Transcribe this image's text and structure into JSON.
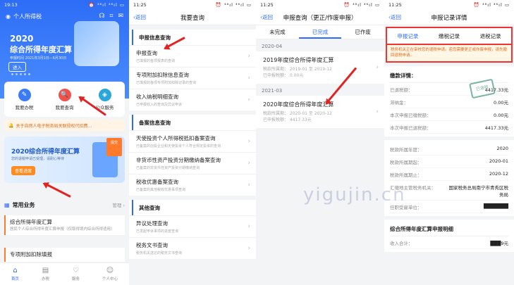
{
  "p1": {
    "time": "19:13",
    "status_right": "⏰ ⁴⁶ıl ⁴⁶ıl ▭",
    "app_title": "个人所得税",
    "banner_year": "2020",
    "banner_title": "综合所得年度汇算",
    "banner_sub": "申报时间 2021年3月1日—6月30日",
    "banner_btn": "进入",
    "quick": [
      {
        "label": "我要办税",
        "color": "#3b7bf6",
        "icon": "✎"
      },
      {
        "label": "我要查询",
        "color": "#f0524b",
        "icon": "🔍"
      },
      {
        "label": "公众服务",
        "color": "#2aa7d8",
        "icon": "◈"
      }
    ],
    "notice": "关于自然人电子税务局关联授权代扣费…",
    "promo_title": "2020综合所得年度汇算",
    "promo_sub": "您的退税申请已受理，请耐心等待",
    "promo_btn": "查看进度",
    "promo_ribbon": "提交",
    "common": "常用业务",
    "manage": "管理 ›",
    "items": [
      {
        "a": "综合所得年度汇算",
        "b": "居民个人综合所得年度汇算申报（仅取得境内综合所得适用）"
      },
      {
        "a": "专项附加扣除填报",
        "b": ""
      }
    ],
    "tabbar": [
      {
        "label": "首页",
        "g": "⌂"
      },
      {
        "label": "办税",
        "g": "▤"
      },
      {
        "label": "服务",
        "g": "♡"
      },
      {
        "label": "个人中心",
        "g": "☺"
      }
    ]
  },
  "p2": {
    "time": "11:25",
    "status_right": "⏰ ⁴⁶ıl ⁴⁶ıl ▭",
    "back": "‹返回",
    "title": "我要查询",
    "sections": [
      {
        "h": "申报信息查询",
        "rows": [
          {
            "a": "申报查询",
            "b": "已填报的各项报表的查询"
          },
          {
            "a": "专项附加扣除信息查询",
            "b": "已填报的各项专项附加扣除记录的查询"
          },
          {
            "a": "收入纳税明细查询",
            "b": "已申报收入的查询及异议申诉"
          }
        ]
      },
      {
        "h": "备案信息查询",
        "rows": [
          {
            "a": "天使投资个人所得税抵扣备案查询",
            "b": "已备案的创投企业和天使投资个人符合规定投资的查询"
          },
          {
            "a": "非货币性资产投资分期缴纳备案查询",
            "b": "已备案的非货币性资产投资分期缴纳查询"
          },
          {
            "a": "税收优惠备案查询",
            "b": "已备案的其他税收优惠事项查询"
          }
        ]
      },
      {
        "h": "其他查询",
        "rows": [
          {
            "a": "异议处理查询",
            "b": "已发起申诉事项的进度查询"
          },
          {
            "a": "税务文书查询",
            "b": "税务机关送达的税务文书查询"
          }
        ]
      }
    ]
  },
  "p3": {
    "time": "11:25",
    "status_right": "⏰ ⁴⁶ıl ⁴⁶ıl ▭",
    "back": "‹返回",
    "title": "申报查询（更正/作废申报）",
    "tabs": [
      "未完成",
      "已完成",
      "已作废"
    ],
    "groups": [
      {
        "m": "2020-04",
        "r": {
          "a": "2019年度综合所得年度汇算",
          "b1": "税款所属期： 2019-01 至 2019-12",
          "b2": "已申报税额： 0.00元"
        }
      },
      {
        "m": "2021-03",
        "r": {
          "a": "2020年度综合所得年度汇算",
          "b1": "税款所属期： 2020-01 至 2020-12",
          "b2": "已申报税额： 4417.33元"
        }
      }
    ]
  },
  "p4": {
    "time": "11:25",
    "status_right": "⏰ ⁴⁶ıl ⁴⁶ıl ▭",
    "back": "‹返回",
    "title": "申报记录详情",
    "tabs": [
      "申报记录",
      "缴税记录",
      "退税记录"
    ],
    "warning": "税务机关正在审核您的退税申请。若您需要更正或作废申报，请先撤回退税申请。",
    "pay_title": "缴款详情：",
    "pay": [
      {
        "k": "已退税额：",
        "v": "4417.33元"
      },
      {
        "k": "滞纳金：",
        "v": "0.00元"
      },
      {
        "k": "本次申报已缴税额：",
        "v": "0.00元"
      },
      {
        "k": "本次申报已退税额：",
        "v": "4417.33元"
      }
    ],
    "stamp": "已退税",
    "info": [
      {
        "k": "税款所属年度：",
        "v": "2020"
      },
      {
        "k": "税款所属期起：",
        "v": "2020-01"
      },
      {
        "k": "税款所属期止：",
        "v": "2020-12"
      },
      {
        "k": "汇缴地主管税务机关：",
        "v": "国家税务总局南宁市青秀区税务局"
      },
      {
        "k": "任职受雇单位：",
        "v": "███████"
      }
    ],
    "detail_title": "综合所得年度汇算申报明细",
    "income": {
      "k": "收入合计：",
      "v": "███9元"
    }
  },
  "watermark": "yigujin.cn"
}
